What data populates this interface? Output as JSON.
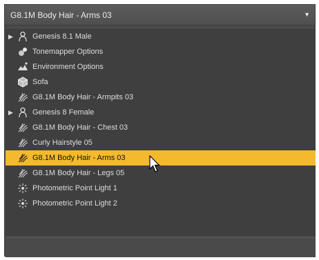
{
  "header": {
    "title": "G8.1M Body Hair - Arms 03",
    "arrow_icon": "dropdown-arrow-icon"
  },
  "rows": [
    {
      "label": "Genesis 8.1 Male",
      "icon": "figure-icon",
      "expandable": true,
      "selected": false
    },
    {
      "label": "Tonemapper Options",
      "icon": "tonemapper-icon",
      "expandable": false,
      "selected": false
    },
    {
      "label": "Environment Options",
      "icon": "environment-icon",
      "expandable": false,
      "selected": false
    },
    {
      "label": "Sofa",
      "icon": "prop-icon",
      "expandable": false,
      "selected": false
    },
    {
      "label": "G8.1M Body Hair - Armpits 03",
      "icon": "hair-icon",
      "expandable": false,
      "selected": false
    },
    {
      "label": "Genesis 8 Female",
      "icon": "figure-icon",
      "expandable": true,
      "selected": false
    },
    {
      "label": "G8.1M Body Hair - Chest 03",
      "icon": "hair-icon",
      "expandable": false,
      "selected": false
    },
    {
      "label": "Curly Hairstyle 05",
      "icon": "hair-icon",
      "expandable": false,
      "selected": false
    },
    {
      "label": "G8.1M Body Hair - Arms 03",
      "icon": "hair-icon",
      "expandable": false,
      "selected": true
    },
    {
      "label": "G8.1M Body Hair - Legs 05",
      "icon": "hair-icon",
      "expandable": false,
      "selected": false
    },
    {
      "label": "Photometric Point Light 1",
      "icon": "point-light-icon",
      "expandable": false,
      "selected": false
    },
    {
      "label": "Photometric Point Light 2",
      "icon": "point-light-icon",
      "expandable": false,
      "selected": false
    }
  ],
  "colors": {
    "panel": "#4a4a4a",
    "list": "#3f3f3f",
    "selected": "#f5b92d",
    "text": "#dedede"
  }
}
